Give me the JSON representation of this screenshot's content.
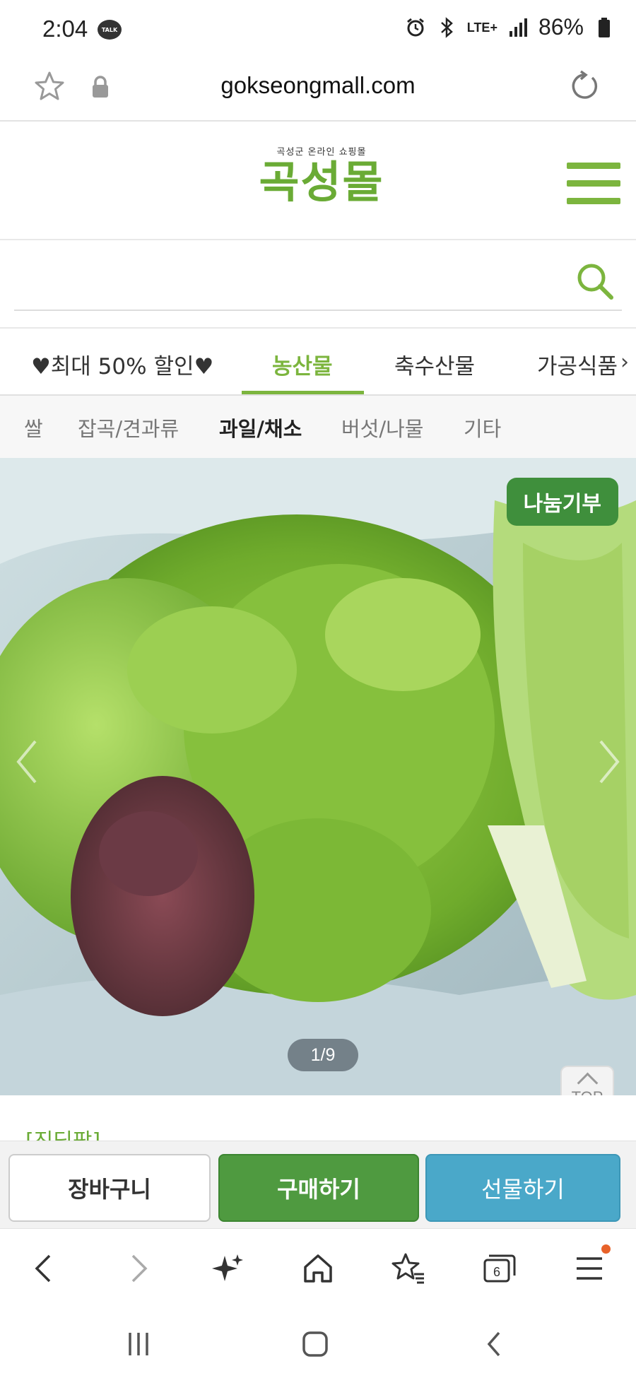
{
  "status_bar": {
    "time": "2:04",
    "talk_badge": "TALK",
    "network": "LTE+",
    "battery": "86%"
  },
  "url_bar": {
    "url": "gokseongmall.com"
  },
  "header": {
    "logo_subtitle": "곡성군 온라인 쇼핑몰",
    "logo_title": "곡성몰"
  },
  "search": {
    "placeholder": ""
  },
  "category_tabs": [
    {
      "label": "♥최대 50% 할인♥",
      "active": false
    },
    {
      "label": "농산물",
      "active": true
    },
    {
      "label": "축수산물",
      "active": false
    },
    {
      "label": "가공식품",
      "active": false
    }
  ],
  "sub_tabs": [
    {
      "label": "쌀",
      "active": false
    },
    {
      "label": "잡곡/견과류",
      "active": false
    },
    {
      "label": "과일/채소",
      "active": true
    },
    {
      "label": "버섯/나물",
      "active": false
    },
    {
      "label": "기타",
      "active": false
    }
  ],
  "product_image": {
    "badge": "나눔기부",
    "counter": "1/9",
    "top_button": "TOP"
  },
  "peek_text": "[진딩팜]",
  "actions": {
    "cart": "장바구니",
    "buy": "구매하기",
    "gift": "선물하기"
  },
  "browser_nav": {
    "tabs_count": "6"
  },
  "colors": {
    "brand_green": "#7cb53e",
    "buy_green": "#4f9a40",
    "gift_blue": "#4aa8c9",
    "badge_green": "#3f8f3c"
  }
}
